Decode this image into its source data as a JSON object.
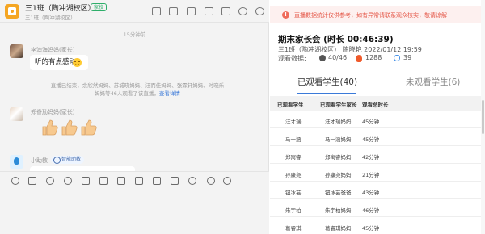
{
  "chat": {
    "group_name": "三1班（陶冲湖校区）",
    "group_badge": "家校",
    "group_sub": "三1班（陶冲湖校区）",
    "time_separator": "15分钟前",
    "messages": [
      {
        "sender": "李澳海妈妈(家长)",
        "text": "听的有点感动",
        "emoji": "smiley"
      },
      {
        "sender": "郑眷劢妈妈(家长)",
        "emoji": "thumbs-up x3"
      },
      {
        "sender": "小助教",
        "tag": "智能助教"
      }
    ],
    "system_message": {
      "line1": "直播已结束，余欣然妈妈、苏城晓妈妈、汪而佳妈妈、张霖轩妈妈、时晓乐",
      "line2": "妈妈等46人观看了该直播，",
      "link": "查看详情"
    }
  },
  "live": {
    "warning": "直播数据统计仅供参考，如有异常请联系观众核实，敬请谅解",
    "title": "期末家长会 (时长 00:46:39)",
    "meta": "三1班（陶冲湖校区） 陈晓艳 2022/01/12 19:59",
    "stats_label": "观看数据:",
    "viewers": "40/46",
    "likes": "1288",
    "comments": "39",
    "tabs": {
      "watched": "已观看学生(40)",
      "unwatched": "未观看学生(6)"
    },
    "table": {
      "headers": [
        "已观看学生",
        "已观看学生家长",
        "观看总时长"
      ],
      "rows": [
        [
          "汪才瑞",
          "汪才瑞妈妈",
          "45分钟"
        ],
        [
          "马一涵",
          "马一涵妈妈",
          "45分钟"
        ],
        [
          "郑寓睿",
          "郑寓睿妈妈",
          "42分钟"
        ],
        [
          "孙康尧",
          "孙康尧妈妈",
          "21分钟"
        ],
        [
          "钮冰芸",
          "钮冰芸爸爸",
          "43分钟"
        ],
        [
          "朱宇柏",
          "朱宇柏妈妈",
          "46分钟"
        ],
        [
          "葛睿琪",
          "葛睿琪妈妈",
          "45分钟"
        ]
      ]
    }
  },
  "colors": {
    "accent": "#3b7ad9",
    "warning_text": "#e55a4b",
    "warning_bg": "#fdf0ef",
    "group_avatar": "#f5a623",
    "badge_green": "#2eae6a"
  }
}
